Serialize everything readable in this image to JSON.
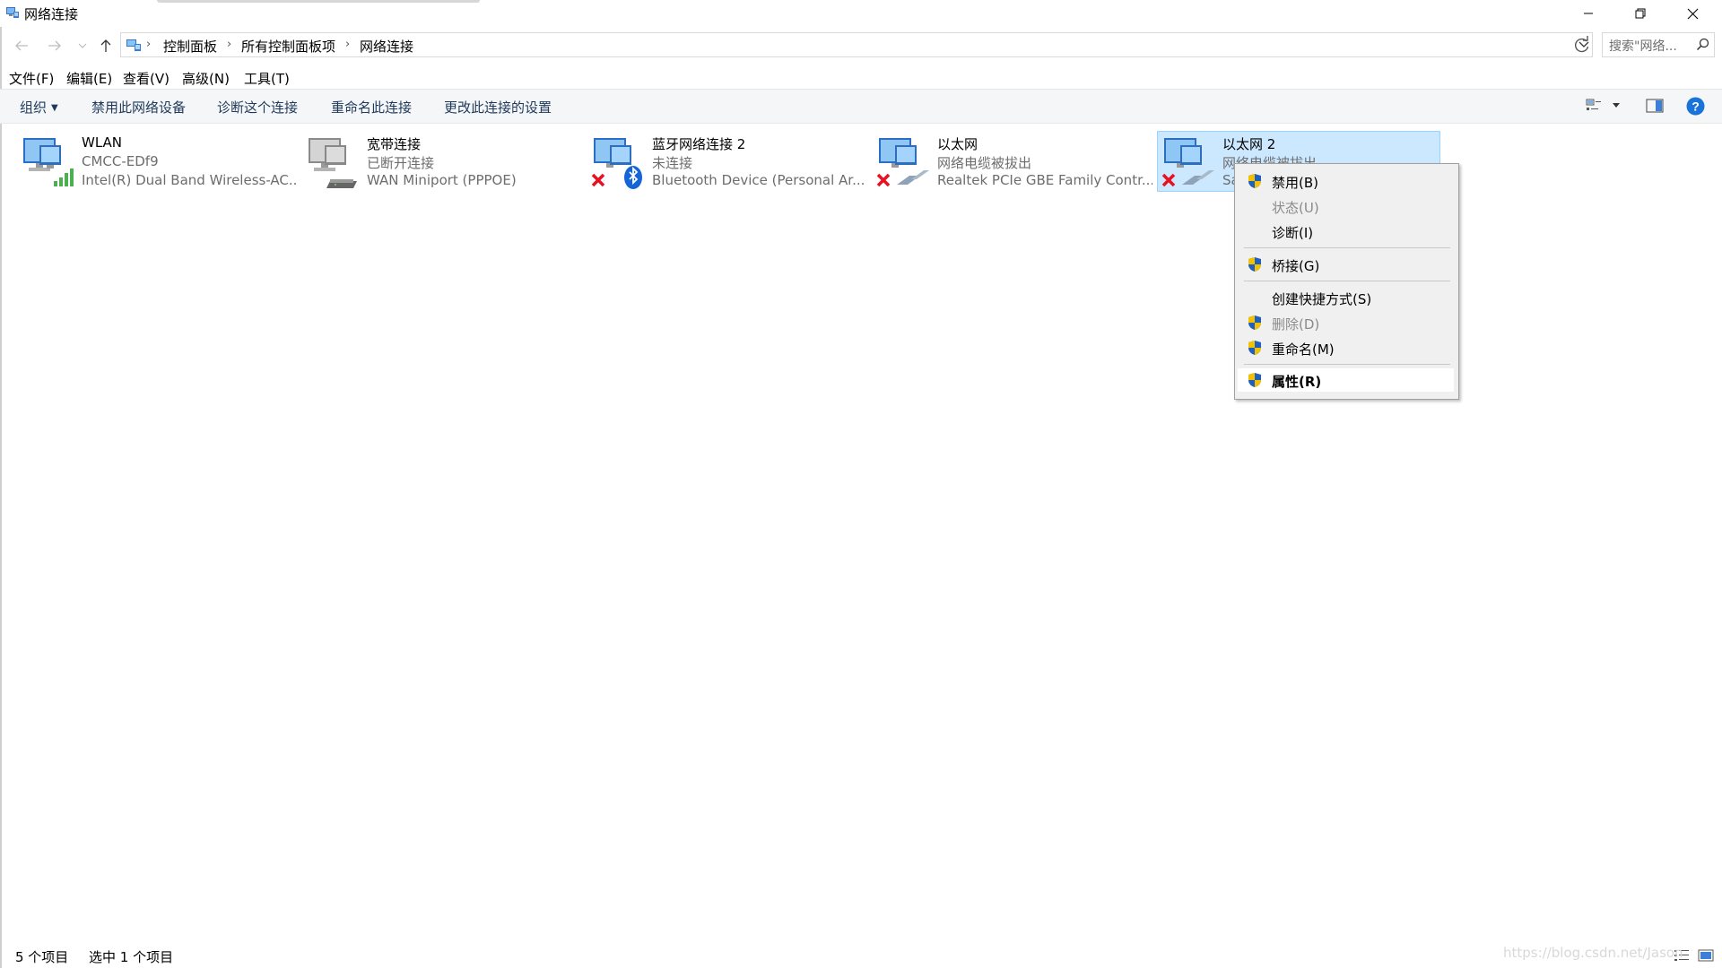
{
  "window": {
    "title": "网络连接"
  },
  "breadcrumbs": [
    "控制面板",
    "所有控制面板项",
    "网络连接"
  ],
  "search": {
    "placeholder": "搜索\"网络..."
  },
  "menu": [
    "文件(F)",
    "编辑(E)",
    "查看(V)",
    "高级(N)",
    "工具(T)"
  ],
  "commands": {
    "organize": "组织",
    "disable": "禁用此网络设备",
    "diagnose": "诊断这个连接",
    "rename": "重命名此连接",
    "change_settings": "更改此连接的设置"
  },
  "connections": [
    {
      "name": "WLAN",
      "status": "CMCC-EDf9",
      "device": "Intel(R) Dual Band Wireless-AC...",
      "icon": "wifi-adapter-icon"
    },
    {
      "name": "宽带连接",
      "status": "已断开连接",
      "device": "WAN Miniport (PPPOE)",
      "icon": "modem-icon"
    },
    {
      "name": "蓝牙网络连接 2",
      "status": "未连接",
      "device": "Bluetooth Device (Personal Ar...",
      "icon": "bluetooth-icon"
    },
    {
      "name": "以太网",
      "status": "网络电缆被拔出",
      "device": "Realtek PCIe GBE Family Contr...",
      "icon": "ethernet-cable-icon"
    },
    {
      "name": "以太网 2",
      "status": "网络电缆被拔出",
      "device": "Sa",
      "icon": "ethernet-cable-icon",
      "selected": true
    }
  ],
  "context_menu": [
    {
      "label": "禁用(B)",
      "shield": true,
      "disabled": false
    },
    {
      "label": "状态(U)",
      "shield": false,
      "disabled": true
    },
    {
      "label": "诊断(I)",
      "shield": false,
      "disabled": false
    },
    {
      "label": "桥接(G)",
      "shield": true,
      "disabled": false
    },
    {
      "label": "创建快捷方式(S)",
      "shield": false,
      "disabled": false
    },
    {
      "label": "删除(D)",
      "shield": true,
      "disabled": true
    },
    {
      "label": "重命名(M)",
      "shield": true,
      "disabled": false
    },
    {
      "label": "属性(R)",
      "shield": true,
      "disabled": false,
      "default": true
    }
  ],
  "status": {
    "count": "5 个项目",
    "selected": "选中 1 个项目",
    "watermark": "https://blog.csdn.net/Jason"
  },
  "colors": {
    "selection_bg": "#cce8ff",
    "selection_border": "#99d1ff",
    "command_text": "#1e395b",
    "disconnected_x": "#e81123",
    "shield_blue": "#1f5fbf",
    "shield_yellow": "#f2c200"
  }
}
